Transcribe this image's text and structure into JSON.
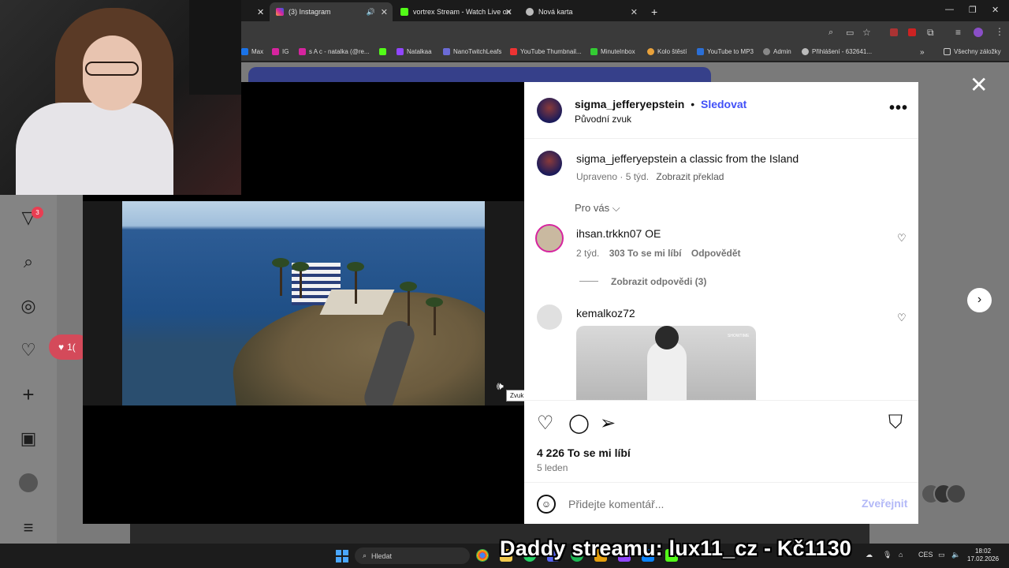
{
  "browser": {
    "tabs": [
      {
        "title": "(3) Instagram",
        "active": true
      },
      {
        "title": "vortrex Stream - Watch Live on",
        "active": false
      },
      {
        "title": "Nová karta",
        "active": false
      }
    ],
    "new_tab": "+",
    "bookmarks": [
      "Max",
      "IG",
      "s A c - natalka (@re...",
      "",
      "Natalkaa",
      "NanoTwitchLeafs",
      "YouTube Thumbnail...",
      "MinuteInbox",
      "Kolo štěstí",
      "YouTube to MP3",
      "Admin",
      "Přihlášení - 632641..."
    ],
    "bookmarks_more": "»",
    "all_bookmarks": "Všechny záložky"
  },
  "sidebar": {
    "notif_badge": "3",
    "notif_pill": "1("
  },
  "video": {
    "tooltip": "Zvuk se přehrává"
  },
  "post": {
    "author": "sigma_jefferyepstein",
    "separator": "•",
    "follow": "Sledovat",
    "audio": "Původní zvuk",
    "caption_user": "sigma_jefferyepstein",
    "caption_text": "a classic from the Island",
    "caption_meta": "Upraveno · 5 týd.",
    "translate": "Zobrazit překlad",
    "for_you": "Pro vás",
    "comments": [
      {
        "user": "ihsan.trkkn07",
        "text": "OE",
        "age": "2 týd.",
        "likes": "303 To se mi líbí",
        "reply": "Odpovědět",
        "view_replies": "Zobrazit odpovědi (3)"
      },
      {
        "user": "kemalkoz72",
        "text": ""
      }
    ],
    "gif_tag": "SHOWTIME",
    "likes": "4 226 To se mi líbí",
    "date": "5 leden",
    "comment_placeholder": "Přidejte komentář...",
    "post_button": "Zveřejnit"
  },
  "taskbar": {
    "search": "Hledat",
    "lang": "CES",
    "time": "18:02",
    "date": "17.02.2026"
  },
  "overlay": "Daddy streamu: lux11_cz - Kč1130",
  "colors": {
    "accent": "#4150f7",
    "post_disabled": "#b3b9f7",
    "badge": "#e83e52"
  }
}
